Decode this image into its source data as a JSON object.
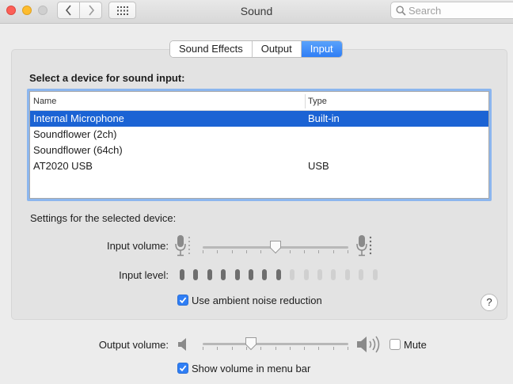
{
  "window": {
    "title": "Sound",
    "search": {
      "placeholder": "Search",
      "value": ""
    }
  },
  "tabs": [
    {
      "label": "Sound Effects",
      "active": false
    },
    {
      "label": "Output",
      "active": false
    },
    {
      "label": "Input",
      "active": true
    }
  ],
  "input": {
    "heading": "Select a device for sound input:",
    "columns": {
      "name": "Name",
      "type": "Type"
    },
    "devices": [
      {
        "name": "Internal Microphone",
        "type": "Built-in",
        "selected": true
      },
      {
        "name": "Soundflower (2ch)",
        "type": "",
        "selected": false
      },
      {
        "name": "Soundflower (64ch)",
        "type": "",
        "selected": false
      },
      {
        "name": "AT2020 USB",
        "type": "USB",
        "selected": false
      }
    ],
    "settings_label": "Settings for the selected device:",
    "volume_label": "Input volume:",
    "volume_fraction": 0.5,
    "level_label": "Input level:",
    "level_lit": 8,
    "level_total": 15,
    "ambient_label": "Use ambient noise reduction",
    "ambient_checked": true
  },
  "output": {
    "volume_label": "Output volume:",
    "volume_fraction": 0.33,
    "mute_label": "Mute",
    "mute_checked": false,
    "menubar_label": "Show volume in menu bar",
    "menubar_checked": true
  },
  "help": {
    "label": "?"
  },
  "colors": {
    "accent": "#2f7ef5",
    "selection": "#1b63d4",
    "level_on": "#6e6e6e",
    "level_off": "#d0d0d0"
  }
}
